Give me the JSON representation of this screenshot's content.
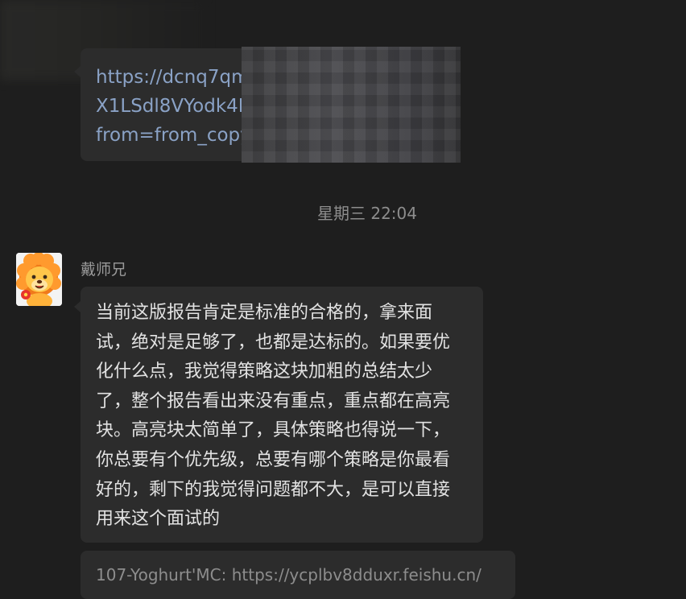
{
  "messages": {
    "link_message": {
      "text": "https://dcnq7qm\nX1LSdl8VYodk4N\nfrom=from_copy"
    },
    "timestamp": "星期三 22:04",
    "reply": {
      "sender": "戴师兄",
      "avatar_icon": "lion-avatar-icon",
      "text": "当前这版报告肯定是标准的合格的，拿来面\n试，绝对是足够了，也都是达标的。如果要优\n化什么点，我觉得策略这块加粗的总结太少\n了，整个报告看出来没有重点，重点都在高亮\n块。高亮块太简单了，具体策略也得说一下，\n你总要有个优先级，总要有哪个策略是你最看\n好的，剩下的我觉得问题都不大，是可以直接\n用来这个面试的"
    },
    "next_message": {
      "text": "107-Yoghurt'MC: https://ycplbv8dduxr.feishu.cn/"
    }
  },
  "colors": {
    "background": "#1e1e1e",
    "bubble": "#2c2c2c",
    "link": "#8aa2c6"
  }
}
